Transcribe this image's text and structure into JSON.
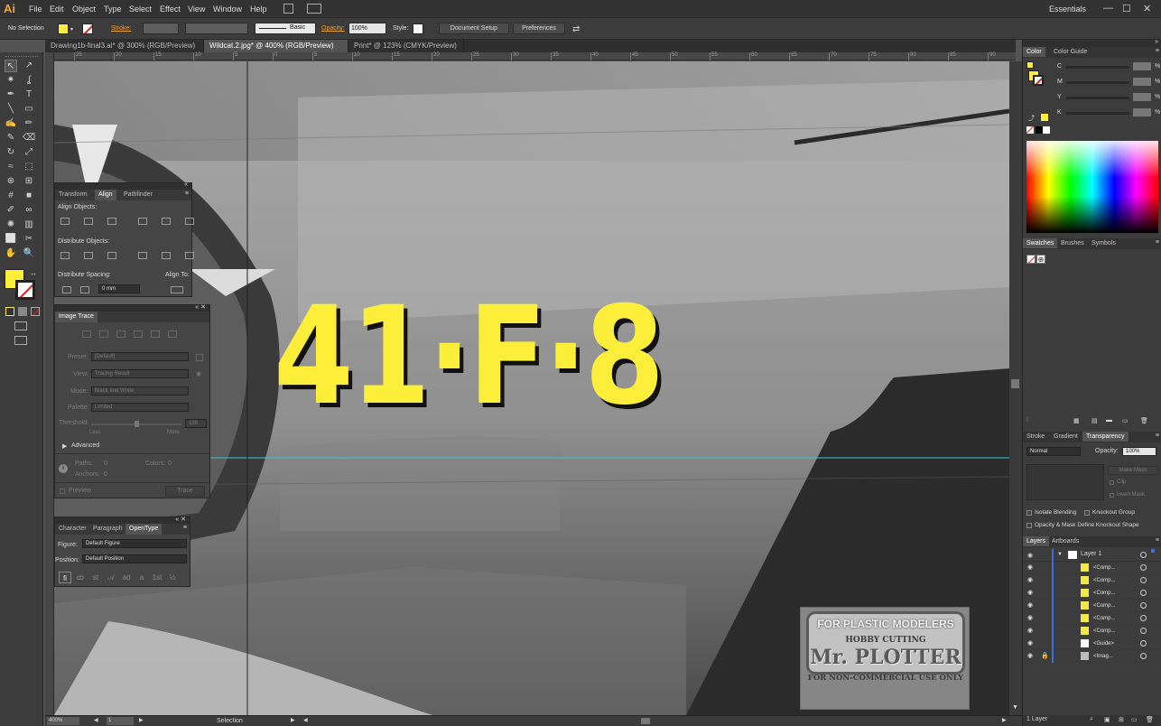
{
  "app": {
    "logo": "Ai",
    "workspace": "Essentials"
  },
  "menu": [
    "File",
    "Edit",
    "Object",
    "Type",
    "Select",
    "Effect",
    "View",
    "Window",
    "Help"
  ],
  "window_buttons": [
    "—",
    "☐",
    "✕"
  ],
  "control_bar": {
    "selection": "No Selection",
    "stroke_label": "Stroke:",
    "brush": "Basic",
    "opacity_label": "Opacity:",
    "opacity": "100%",
    "style_label": "Style:",
    "doc_setup": "Document Setup",
    "preferences": "Preferences"
  },
  "tabs": [
    {
      "label": "Drawing1b-final3.ai* @ 300% (RGB/Preview)",
      "active": false
    },
    {
      "label": "Wildcat.2.jpg* @ 400% (RGB/Preview)",
      "active": true
    },
    {
      "label": "Print* @ 123% (CMYK/Preview)",
      "active": false
    }
  ],
  "ruler_ticks": [
    "25",
    "20",
    "15",
    "10",
    "5",
    "0",
    "5",
    "10",
    "15",
    "20",
    "25",
    "30",
    "35",
    "40",
    "45",
    "50",
    "55",
    "60",
    "65",
    "70",
    "75",
    "80",
    "85",
    "90",
    "95"
  ],
  "align_panel": {
    "tabs": [
      "Transform",
      "Align",
      "Pathfinder"
    ],
    "align_objects": "Align Objects:",
    "distribute_objects": "Distribute Objects:",
    "distribute_spacing": "Distribute Spacing:",
    "align_to": "Align To:",
    "spacing_value": "0 mm"
  },
  "image_trace": {
    "title": "Image Trace",
    "preset_label": "Preset:",
    "preset": "[Default]",
    "view_label": "View:",
    "view": "Tracing Result",
    "mode_label": "Mode:",
    "mode": "Black and White",
    "palette_label": "Palette:",
    "palette": "Limited",
    "threshold_label": "Threshold:",
    "threshold": "128",
    "threshold_fraction": 0.5,
    "less": "Less",
    "more": "More",
    "advanced": "Advanced",
    "paths_label": "Paths:",
    "paths": "0",
    "colors_label": "Colors:",
    "colors": "0",
    "anchors_label": "Anchors:",
    "anchors": "0",
    "preview": "Preview",
    "trace": "Trace"
  },
  "character_panel": {
    "tabs": [
      "Character",
      "Paragraph",
      "OpenType"
    ],
    "figure_label": "Figure:",
    "figure": "Default Figure",
    "position_label": "Position:",
    "position": "Default Position",
    "glyphs": [
      "fi",
      "ꝏ",
      "st",
      "𝒜",
      "ad",
      "a",
      "1st",
      "½"
    ]
  },
  "canvas": {
    "marking": "41·F·8",
    "marking_color": "#fdee3a",
    "watermark": {
      "line1": "FOR PLASTIC MODELERS",
      "line2": "HOBBY CUTTING",
      "line3": "Mr. PLOTTER",
      "line4": "FOR NON-COMMERCIAL USE ONLY"
    }
  },
  "status": {
    "zoom": "400%",
    "page": "1",
    "tool": "Selection"
  },
  "color_panel": {
    "tabs": [
      "Color",
      "Color Guide"
    ],
    "channels": [
      {
        "label": "C",
        "value": ""
      },
      {
        "label": "M",
        "value": ""
      },
      {
        "label": "Y",
        "value": ""
      },
      {
        "label": "K",
        "value": ""
      }
    ],
    "pct": "%"
  },
  "swatches_panel": {
    "tabs": [
      "Swatches",
      "Brushes",
      "Symbols"
    ]
  },
  "transparency_panel": {
    "tabs": [
      "Stroke",
      "Gradient",
      "Transparency"
    ],
    "mode": "Normal",
    "opacity_label": "Opacity:",
    "opacity": "100%",
    "make_mask": "Make Mask",
    "clip": "Clip",
    "invert_mask": "Invert Mask",
    "isolate": "Isolate Blending",
    "knockout": "Knockout Group",
    "opacity_mask": "Opacity & Mask Define Knockout Shape"
  },
  "layers_panel": {
    "tabs": [
      "Layers",
      "Artboards"
    ],
    "layer": "Layer 1",
    "items": [
      "<Comp...",
      "<Comp...",
      "<Comp...",
      "<Comp...",
      "<Comp...",
      "<Comp...",
      "<Guide>",
      "<Imag..."
    ],
    "footer": "1 Layer"
  }
}
